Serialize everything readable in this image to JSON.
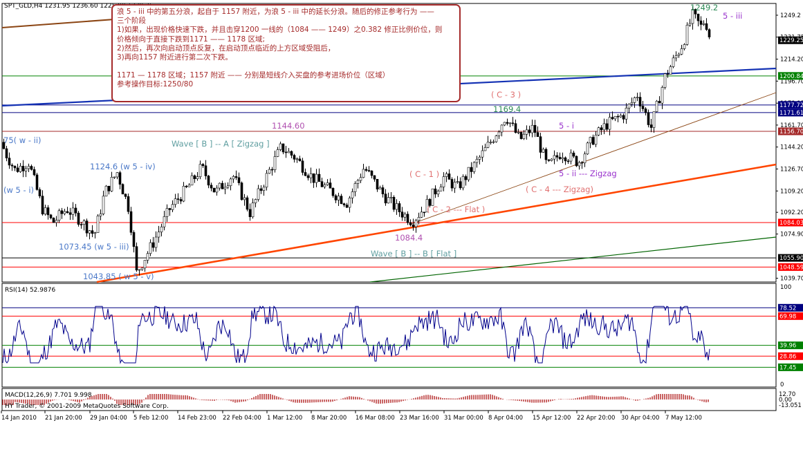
{
  "header": {
    "symbol_info": "SPT_GLD,H4  1231.95 1236.60 1225.90 1229.25"
  },
  "annotation": {
    "lines": [
      "浪 5 - iii 中的第五分浪，起自于 1157 附近，为浪 5 - iii 中的延长分浪。随后的修正参考行为 ——",
      "三个阶段",
      "1)如果，出现价格快速下跌，并且击穿1200 一线的（1084 —— 1249）之0.382 修正比例价位，则",
      "价格倾向于直接下跌到1171 —— 1178 区域;",
      "2)然后，再次向启动顶点反复，在启动顶点临近的上方区域受阻后，",
      "3)再向1157 附近进行第二次下跌。",
      "",
      "1171 — 1178 区域；1157 附近   ——   分别是短线介入买盘的参考进场价位（区域）",
      "参考操作目标:1250/80"
    ]
  },
  "chart_data": [
    {
      "type": "candlestick",
      "title": "SPT_GLD,H4",
      "ohlc_last": {
        "open": 1231.95,
        "high": 1236.6,
        "low": 1225.9,
        "close": 1229.25
      },
      "ylim": [
        1035,
        1262
      ],
      "y_ticks": [
        1249.2,
        1231.75,
        1214.2,
        1196.7,
        1179.15,
        1161.7,
        1144.2,
        1126.7,
        1109.2,
        1092.2,
        1074.9,
        1039.7
      ],
      "x_tick_labels": [
        "14 Jan 2010",
        "21 Jan 20:00",
        "29 Jan 04:00",
        "5 Feb 12:00",
        "14 Feb 23:00",
        "22 Feb 04:00",
        "1 Mar 12:00",
        "8 Mar 20:00",
        "16 Mar 08:00",
        "23 Mar 16:00",
        "31 Mar 00:00",
        "8 Apr 04:00",
        "15 Apr 12:00",
        "22 Apr 20:00",
        "30 Apr 04:00",
        "7 May 12:00"
      ],
      "price_tags": [
        {
          "label": "1229.25",
          "value": 1229.25,
          "color": "#000000",
          "text_color": "#ffffff"
        },
        {
          "label": "1200.84",
          "value": 1200.84,
          "color": "#008000",
          "text_color": "#ffffff"
        },
        {
          "label": "1177.72",
          "value": 1177.72,
          "color": "#000080",
          "text_color": "#ffffff"
        },
        {
          "label": "1171.61",
          "value": 1171.61,
          "color": "#000080",
          "text_color": "#ffffff"
        },
        {
          "label": "1156.70",
          "value": 1156.7,
          "color": "#a52a2a",
          "text_color": "#ffffff"
        },
        {
          "label": "1084.03",
          "value": 1084.03,
          "color": "#ff0000",
          "text_color": "#ffffff"
        },
        {
          "label": "1055.90",
          "value": 1055.9,
          "color": "#000000",
          "text_color": "#ffffff"
        },
        {
          "label": "1048.59",
          "value": 1048.59,
          "color": "#ff0000",
          "text_color": "#ffffff"
        }
      ],
      "horizontal_levels": [
        {
          "value": 1200.84,
          "color": "#008000"
        },
        {
          "value": 1177.72,
          "color": "#000080"
        },
        {
          "value": 1171.61,
          "color": "#000080"
        },
        {
          "value": 1156.7,
          "color": "#a52a2a"
        },
        {
          "value": 1084.03,
          "color": "#ff0000"
        },
        {
          "value": 1055.9,
          "color": "#000000"
        },
        {
          "value": 1048.59,
          "color": "#ff0000"
        }
      ],
      "key_points": [
        {
          "label": "1043.85",
          "value": 1043.85
        },
        {
          "label": "1124.6",
          "value": 1124.6
        },
        {
          "label": "1073.45",
          "value": 1073.45
        },
        {
          "label": "1144.60",
          "value": 1144.6
        },
        {
          "label": "1084.4",
          "value": 1084.4
        },
        {
          "label": "1169.4",
          "value": 1169.4
        },
        {
          "label": "1249.2",
          "value": 1249.2
        }
      ],
      "wave_labels": [
        {
          "text": "75( w - ii)",
          "color": "#4a78c8"
        },
        {
          "text": "(w 5 - i)",
          "color": "#4a78c8"
        },
        {
          "text": "1124.6 (w 5 - iv)",
          "color": "#4a78c8"
        },
        {
          "text": "1073.45 (w 5 - iii)",
          "color": "#4a78c8"
        },
        {
          "text": "1043.85 ( w 5 - v)",
          "color": "#4a78c8"
        },
        {
          "text": "Wave [ B ] -- A [ Zigzag ]",
          "color": "#5f9ea0"
        },
        {
          "text": "1144.60",
          "color": "#b050b0"
        },
        {
          "text": "( C - 1 )",
          "color": "#e07070"
        },
        {
          "text": "( C - 2 --- Flat )",
          "color": "#e07070"
        },
        {
          "text": "1084.4",
          "color": "#b050b0"
        },
        {
          "text": "Wave [ B ] -- B [ Flat ]",
          "color": "#5f9ea0"
        },
        {
          "text": "( C - 3 )",
          "color": "#e07070"
        },
        {
          "text": "1169.4",
          "color": "#2e8b57"
        },
        {
          "text": "5 - i",
          "color": "#9932cc"
        },
        {
          "text": "5 - ii --- Zigzag",
          "color": "#9932cc"
        },
        {
          "text": "( C - 4 --- Zigzag)",
          "color": "#e07070"
        },
        {
          "text": "1249.2",
          "color": "#2e8b57"
        },
        {
          "text": "5 - iii",
          "color": "#9932cc"
        }
      ],
      "key_path": [
        [
          0,
          1148
        ],
        [
          8,
          1138
        ],
        [
          20,
          1126
        ],
        [
          40,
          1132
        ],
        [
          60,
          1095
        ],
        [
          75,
          1084
        ],
        [
          95,
          1095
        ],
        [
          115,
          1086
        ],
        [
          135,
          1074
        ],
        [
          150,
          1108
        ],
        [
          168,
          1124
        ],
        [
          185,
          1095
        ],
        [
          196,
          1044
        ],
        [
          220,
          1068
        ],
        [
          245,
          1096
        ],
        [
          270,
          1112
        ],
        [
          290,
          1128
        ],
        [
          310,
          1108
        ],
        [
          335,
          1122
        ],
        [
          360,
          1092
        ],
        [
          385,
          1122
        ],
        [
          405,
          1144
        ],
        [
          425,
          1136
        ],
        [
          450,
          1120
        ],
        [
          475,
          1110
        ],
        [
          500,
          1100
        ],
        [
          525,
          1128
        ],
        [
          550,
          1108
        ],
        [
          570,
          1096
        ],
        [
          595,
          1085
        ],
        [
          615,
          1098
        ],
        [
          640,
          1120
        ],
        [
          660,
          1112
        ],
        [
          685,
          1130
        ],
        [
          710,
          1150
        ],
        [
          730,
          1169
        ],
        [
          750,
          1150
        ],
        [
          770,
          1160
        ],
        [
          790,
          1128
        ],
        [
          810,
          1140
        ],
        [
          835,
          1132
        ],
        [
          855,
          1150
        ],
        [
          875,
          1162
        ],
        [
          900,
          1170
        ],
        [
          920,
          1186
        ],
        [
          940,
          1160
        ],
        [
          960,
          1200
        ],
        [
          985,
          1226
        ],
        [
          1000,
          1249
        ],
        [
          1012,
          1240
        ],
        [
          1018,
          1246
        ],
        [
          1026,
          1229
        ]
      ]
    },
    {
      "type": "line",
      "title": "RSI(14) 52.9876",
      "ylim": [
        0,
        100
      ],
      "y_ticks": [
        100,
        78.52,
        69.98,
        39.96,
        28.86,
        17.45,
        0
      ],
      "levels": [
        {
          "label": "78.52",
          "value": 78.52,
          "color": "#000080",
          "text_color": "#ffffff"
        },
        {
          "label": "69.98",
          "value": 69.98,
          "color": "#ff0000",
          "text_color": "#ffffff"
        },
        {
          "label": "39.96",
          "value": 39.96,
          "color": "#008000",
          "text_color": "#ffffff"
        },
        {
          "label": "28.86",
          "value": 28.86,
          "color": "#ff0000",
          "text_color": "#ffffff"
        },
        {
          "label": "17.45",
          "value": 17.45,
          "color": "#008000",
          "text_color": "#ffffff"
        }
      ],
      "current": 52.9876
    },
    {
      "type": "bar",
      "title": "MACD(12,26,9) 7.701 9.998",
      "y_ticks": [
        12.7,
        0.0,
        -13.051
      ],
      "macd": 7.701,
      "signal": 9.998
    }
  ],
  "footer": {
    "watermark": "HY Trader, © 2001-2009 MetaQuotes Software Corp."
  }
}
